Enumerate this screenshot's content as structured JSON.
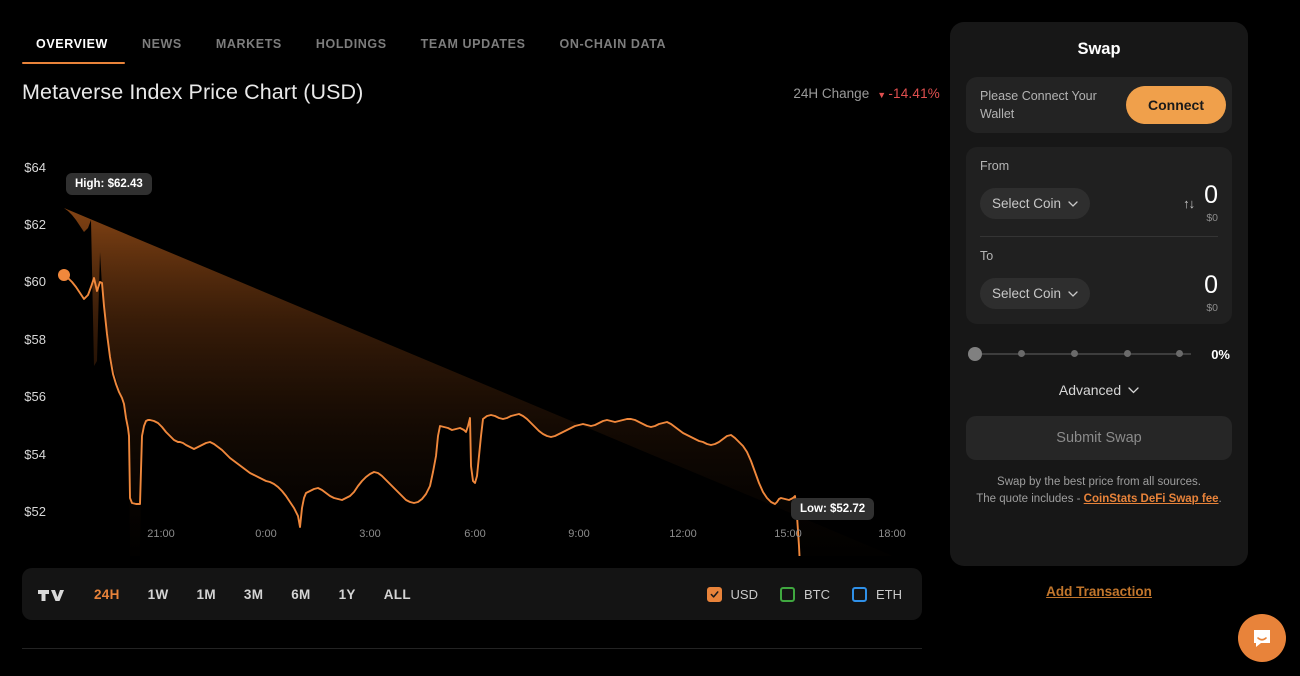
{
  "tabs": [
    {
      "label": "OVERVIEW",
      "active": true
    },
    {
      "label": "NEWS",
      "active": false
    },
    {
      "label": "MARKETS",
      "active": false
    },
    {
      "label": "HOLDINGS",
      "active": false
    },
    {
      "label": "TEAM UPDATES",
      "active": false
    },
    {
      "label": "ON-CHAIN DATA",
      "active": false
    }
  ],
  "header": {
    "title": "Metaverse Index Price Chart (USD)",
    "change_label": "24H Change",
    "change_value": "-14.41%",
    "change_caret": "▼",
    "change_color": "#e04f4f"
  },
  "chart_data": {
    "type": "line",
    "title": "Metaverse Index Price Chart (USD)",
    "xlabel": "",
    "ylabel": "USD",
    "ylim": [
      51.2,
      64.6
    ],
    "yticks": [
      "$64",
      "$62",
      "$60",
      "$58",
      "$56",
      "$54",
      "$52"
    ],
    "ytick_values": [
      64,
      62,
      60,
      58,
      56,
      54,
      52
    ],
    "xticks": [
      "21:00",
      "0:00",
      "3:00",
      "6:00",
      "9:00",
      "12:00",
      "15:00",
      "18:00"
    ],
    "grid": false,
    "legend": "none",
    "line_color": "#f0883c",
    "fill_gradient": [
      "#6b3a14",
      "#000000"
    ],
    "high_marker": {
      "label": "High: $62.43",
      "value": 62.43,
      "time": "20:10"
    },
    "low_marker": {
      "label": "Low: $52.72",
      "value": 52.72,
      "time": "17:55"
    },
    "x": [
      0,
      0.6,
      1.2,
      1.8,
      2.4,
      3.0,
      3.4,
      3.8,
      4.2,
      4.6,
      5.0,
      5.4,
      5.8,
      6.2,
      6.6,
      7.0,
      7.4,
      7.8,
      8.2,
      8.6,
      9.0,
      9.4,
      9.8,
      10.2,
      10.6,
      11.0,
      11.6,
      12.2,
      12.8,
      13.4,
      14.0,
      14.6,
      15.2,
      15.8,
      16.4,
      17.0,
      17.6,
      18.2,
      18.8,
      19.4,
      20.0,
      20.6,
      21.2,
      21.8,
      22.4,
      23.0,
      23.6,
      24.2,
      24.8,
      25.4,
      26.0,
      26.6,
      27.2,
      27.8,
      28.4,
      29.0,
      29.6,
      30.2,
      30.8,
      31.4,
      32.0,
      32.6,
      33.2,
      33.8,
      34.4,
      35.0,
      35.6,
      36.2,
      36.8,
      37.4,
      38.0,
      38.6,
      39.2,
      39.8,
      40.4,
      41.0,
      41.6,
      42.2,
      42.8,
      43.4,
      44.0,
      44.6,
      45.2,
      45.8,
      46.4,
      47.0,
      47.6,
      48.2,
      48.8,
      49.4,
      50.0
    ],
    "values": [
      62.43,
      62.35,
      62.1,
      61.9,
      61.75,
      61.6,
      61.9,
      62.2,
      61.55,
      61.1,
      60.4,
      59.5,
      58.8,
      58.3,
      57.9,
      57.6,
      57.4,
      57.1,
      56.9,
      56.6,
      56.25,
      56.35,
      56.3,
      55.0,
      53.6,
      53.3,
      53.25,
      53.3,
      56.0,
      56.2,
      56.1,
      55.9,
      56.0,
      55.85,
      55.9,
      55.7,
      53.3,
      55.2,
      55.0,
      54.85,
      54.9,
      55.1,
      55.3,
      55.2,
      55.0,
      54.7,
      54.5,
      54.35,
      54.4,
      54.6,
      54.9,
      55.2,
      55.5,
      55.8,
      56.3,
      57.2,
      58.9,
      58.85,
      58.8,
      58.7,
      58.6,
      58.9,
      58.5,
      56.9,
      58.9,
      59.1,
      59.0,
      58.8,
      58.9,
      59.0,
      58.85,
      58.7,
      58.55,
      58.5,
      58.6,
      58.9,
      59.0,
      58.95,
      58.9,
      58.8,
      58.6,
      58.4,
      58.2,
      58.1,
      58.3,
      58.6,
      58.5,
      58.2,
      57.9,
      57.6,
      57.3
    ],
    "values_tail": [
      57.1,
      56.9,
      56.8,
      56.9,
      56.8,
      57.2,
      57.0,
      55.2,
      54.6,
      54.5,
      53.0,
      53.1,
      53.3,
      53.2,
      53.0,
      52.95,
      53.0,
      52.9,
      52.85,
      52.95,
      52.9,
      52.85,
      52.72,
      52.8,
      53.05,
      52.95,
      53.3,
      53.2
    ]
  },
  "toolbar": {
    "logo_name": "tradingview-logo",
    "ranges": [
      {
        "label": "24H",
        "active": true
      },
      {
        "label": "1W",
        "active": false
      },
      {
        "label": "1M",
        "active": false
      },
      {
        "label": "3M",
        "active": false
      },
      {
        "label": "6M",
        "active": false
      },
      {
        "label": "1Y",
        "active": false
      },
      {
        "label": "ALL",
        "active": false
      }
    ],
    "currencies": [
      {
        "label": "USD",
        "checked": true,
        "color": "#e8833a"
      },
      {
        "label": "BTC",
        "checked": false,
        "color": "#3fa73f"
      },
      {
        "label": "ETH",
        "checked": false,
        "color": "#2f90e8"
      }
    ]
  },
  "swap": {
    "title": "Swap",
    "connect_text": "Please Connect Your Wallet",
    "connect_button": "Connect",
    "from_label": "From",
    "from_coin": "Select Coin",
    "from_amount": "0",
    "from_amount_usd": "$0",
    "to_label": "To",
    "to_coin": "Select Coin",
    "to_amount": "0",
    "to_amount_usd": "$0",
    "slider_percent": "0%",
    "advanced_label": "Advanced",
    "submit_label": "Submit Swap",
    "note_line1": "Swap by the best price from all sources.",
    "note_line2_prefix": "The quote includes - ",
    "note_link": "CoinStats DeFi Swap fee",
    "note_line2_suffix": ".",
    "add_transaction": "Add Transaction"
  }
}
